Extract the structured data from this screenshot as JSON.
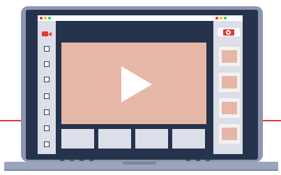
{
  "scene": {
    "colors": {
      "accent": "#e53935",
      "screen_bg": "#26334d",
      "panel": "#dcdfe7",
      "video": "#e6b6a6",
      "frame": "#8c96b0"
    }
  },
  "browser": {
    "window_dots": [
      "#e53935",
      "#ffc107",
      "#2ecc71"
    ],
    "right_dots": [
      "#e53935",
      "#ffc107",
      "#2ecc71"
    ]
  },
  "sidebar_left": {
    "icon": "camera-icon",
    "checkbox_count": 7
  },
  "video": {
    "icon": "play-icon"
  },
  "thumbnails": {
    "count": 4
  },
  "sidebar_right": {
    "icon": "camera-snapshot-icon",
    "tile_count": 4
  }
}
